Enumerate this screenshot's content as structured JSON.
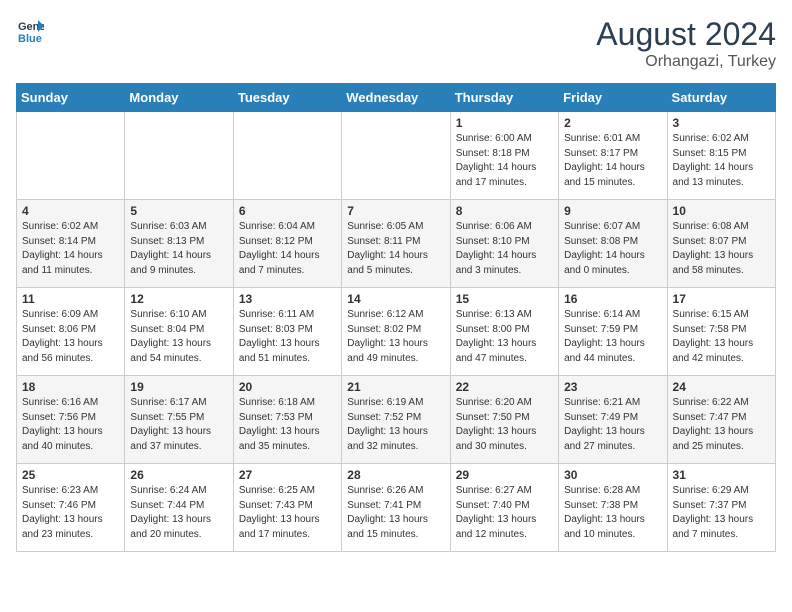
{
  "header": {
    "logo_line1": "General",
    "logo_line2": "Blue",
    "month_year": "August 2024",
    "location": "Orhangazi, Turkey"
  },
  "weekdays": [
    "Sunday",
    "Monday",
    "Tuesday",
    "Wednesday",
    "Thursday",
    "Friday",
    "Saturday"
  ],
  "weeks": [
    [
      {
        "day": "",
        "info": ""
      },
      {
        "day": "",
        "info": ""
      },
      {
        "day": "",
        "info": ""
      },
      {
        "day": "",
        "info": ""
      },
      {
        "day": "1",
        "info": "Sunrise: 6:00 AM\nSunset: 8:18 PM\nDaylight: 14 hours\nand 17 minutes."
      },
      {
        "day": "2",
        "info": "Sunrise: 6:01 AM\nSunset: 8:17 PM\nDaylight: 14 hours\nand 15 minutes."
      },
      {
        "day": "3",
        "info": "Sunrise: 6:02 AM\nSunset: 8:15 PM\nDaylight: 14 hours\nand 13 minutes."
      }
    ],
    [
      {
        "day": "4",
        "info": "Sunrise: 6:02 AM\nSunset: 8:14 PM\nDaylight: 14 hours\nand 11 minutes."
      },
      {
        "day": "5",
        "info": "Sunrise: 6:03 AM\nSunset: 8:13 PM\nDaylight: 14 hours\nand 9 minutes."
      },
      {
        "day": "6",
        "info": "Sunrise: 6:04 AM\nSunset: 8:12 PM\nDaylight: 14 hours\nand 7 minutes."
      },
      {
        "day": "7",
        "info": "Sunrise: 6:05 AM\nSunset: 8:11 PM\nDaylight: 14 hours\nand 5 minutes."
      },
      {
        "day": "8",
        "info": "Sunrise: 6:06 AM\nSunset: 8:10 PM\nDaylight: 14 hours\nand 3 minutes."
      },
      {
        "day": "9",
        "info": "Sunrise: 6:07 AM\nSunset: 8:08 PM\nDaylight: 14 hours\nand 0 minutes."
      },
      {
        "day": "10",
        "info": "Sunrise: 6:08 AM\nSunset: 8:07 PM\nDaylight: 13 hours\nand 58 minutes."
      }
    ],
    [
      {
        "day": "11",
        "info": "Sunrise: 6:09 AM\nSunset: 8:06 PM\nDaylight: 13 hours\nand 56 minutes."
      },
      {
        "day": "12",
        "info": "Sunrise: 6:10 AM\nSunset: 8:04 PM\nDaylight: 13 hours\nand 54 minutes."
      },
      {
        "day": "13",
        "info": "Sunrise: 6:11 AM\nSunset: 8:03 PM\nDaylight: 13 hours\nand 51 minutes."
      },
      {
        "day": "14",
        "info": "Sunrise: 6:12 AM\nSunset: 8:02 PM\nDaylight: 13 hours\nand 49 minutes."
      },
      {
        "day": "15",
        "info": "Sunrise: 6:13 AM\nSunset: 8:00 PM\nDaylight: 13 hours\nand 47 minutes."
      },
      {
        "day": "16",
        "info": "Sunrise: 6:14 AM\nSunset: 7:59 PM\nDaylight: 13 hours\nand 44 minutes."
      },
      {
        "day": "17",
        "info": "Sunrise: 6:15 AM\nSunset: 7:58 PM\nDaylight: 13 hours\nand 42 minutes."
      }
    ],
    [
      {
        "day": "18",
        "info": "Sunrise: 6:16 AM\nSunset: 7:56 PM\nDaylight: 13 hours\nand 40 minutes."
      },
      {
        "day": "19",
        "info": "Sunrise: 6:17 AM\nSunset: 7:55 PM\nDaylight: 13 hours\nand 37 minutes."
      },
      {
        "day": "20",
        "info": "Sunrise: 6:18 AM\nSunset: 7:53 PM\nDaylight: 13 hours\nand 35 minutes."
      },
      {
        "day": "21",
        "info": "Sunrise: 6:19 AM\nSunset: 7:52 PM\nDaylight: 13 hours\nand 32 minutes."
      },
      {
        "day": "22",
        "info": "Sunrise: 6:20 AM\nSunset: 7:50 PM\nDaylight: 13 hours\nand 30 minutes."
      },
      {
        "day": "23",
        "info": "Sunrise: 6:21 AM\nSunset: 7:49 PM\nDaylight: 13 hours\nand 27 minutes."
      },
      {
        "day": "24",
        "info": "Sunrise: 6:22 AM\nSunset: 7:47 PM\nDaylight: 13 hours\nand 25 minutes."
      }
    ],
    [
      {
        "day": "25",
        "info": "Sunrise: 6:23 AM\nSunset: 7:46 PM\nDaylight: 13 hours\nand 23 minutes."
      },
      {
        "day": "26",
        "info": "Sunrise: 6:24 AM\nSunset: 7:44 PM\nDaylight: 13 hours\nand 20 minutes."
      },
      {
        "day": "27",
        "info": "Sunrise: 6:25 AM\nSunset: 7:43 PM\nDaylight: 13 hours\nand 17 minutes."
      },
      {
        "day": "28",
        "info": "Sunrise: 6:26 AM\nSunset: 7:41 PM\nDaylight: 13 hours\nand 15 minutes."
      },
      {
        "day": "29",
        "info": "Sunrise: 6:27 AM\nSunset: 7:40 PM\nDaylight: 13 hours\nand 12 minutes."
      },
      {
        "day": "30",
        "info": "Sunrise: 6:28 AM\nSunset: 7:38 PM\nDaylight: 13 hours\nand 10 minutes."
      },
      {
        "day": "31",
        "info": "Sunrise: 6:29 AM\nSunset: 7:37 PM\nDaylight: 13 hours\nand 7 minutes."
      }
    ]
  ]
}
